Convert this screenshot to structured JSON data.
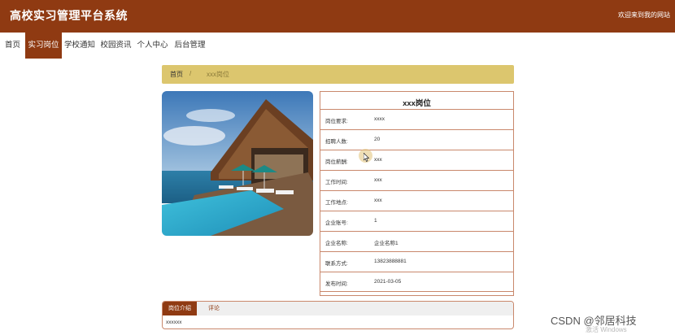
{
  "header": {
    "title": "高校实习管理平台系统",
    "welcome": "欢迎来到我的网站",
    "bg_color": "#8f3a12"
  },
  "nav": {
    "items": [
      "首页",
      "实习岗位",
      "学校通知",
      "校园资讯",
      "个人中心",
      "后台管理"
    ],
    "active_index": 1
  },
  "breadcrumb": {
    "home": "首页",
    "separator": "/",
    "current": "xxx岗位"
  },
  "photo": {
    "icon": "house-pool-photo"
  },
  "details": {
    "title": "xxx岗位",
    "rows": [
      {
        "label": "岗位要求:",
        "value": "xxxx"
      },
      {
        "label": "招聘人数:",
        "value": "20"
      },
      {
        "label": "岗位薪酬:",
        "value": "xxx"
      },
      {
        "label": "工作时间:",
        "value": "xxx"
      },
      {
        "label": "工作地点:",
        "value": "xxx"
      },
      {
        "label": "企业账号:",
        "value": "1"
      },
      {
        "label": "企业名称:",
        "value": "企业名称1"
      },
      {
        "label": "联系方式:",
        "value": "13823888881"
      },
      {
        "label": "发布时间:",
        "value": "2021-03-05"
      }
    ]
  },
  "tabs": {
    "items": [
      "岗位介绍",
      "评论"
    ],
    "active_index": 0,
    "content": "xxxxxx"
  },
  "watermark": {
    "text": "CSDN @邻居科技",
    "windows_text": "激活 Windows"
  }
}
